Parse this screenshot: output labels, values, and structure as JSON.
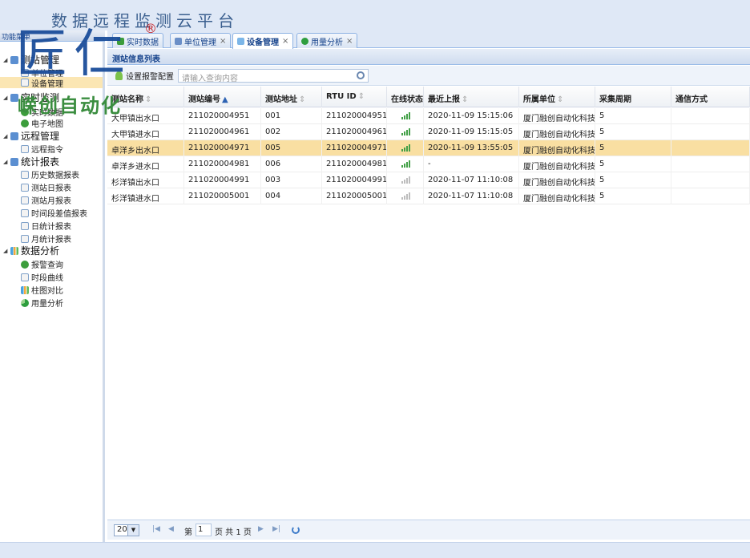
{
  "app": {
    "title": "数据远程监测云平台"
  },
  "nav": {
    "header": "功能菜单",
    "groups": [
      {
        "label": "测站管理",
        "items": [
          "单位管理",
          "设备管理"
        ]
      },
      {
        "label": "实时监测",
        "items": [
          "实时数据",
          "电子地图"
        ]
      },
      {
        "label": "远程管理",
        "items": [
          "远程指令"
        ]
      },
      {
        "label": "统计报表",
        "items": [
          "历史数据报表",
          "测站日报表",
          "测站月报表",
          "时间段差值报表",
          "日统计报表",
          "月统计报表"
        ]
      },
      {
        "label": "数据分析",
        "items": [
          "报警查询",
          "时段曲线",
          "柱图对比",
          "用量分析"
        ]
      }
    ]
  },
  "watermark": {
    "big": "匠仁",
    "reg": "®",
    "sub": "嵘创自动化"
  },
  "tabs": [
    {
      "label": "实时数据",
      "close": ""
    },
    {
      "label": "单位管理",
      "close": "×"
    },
    {
      "label": "设备管理",
      "close": "×"
    },
    {
      "label": "用量分析",
      "close": "×"
    }
  ],
  "panel": {
    "title": "测站信息列表"
  },
  "toolbar": {
    "alarm_config": "设置报警配置",
    "search_placeholder": "请输入查询内容"
  },
  "grid": {
    "columns": [
      "测站名称",
      "测站编号",
      "测站地址",
      "RTU ID",
      "在线状态",
      "最近上报",
      "所属单位",
      "采集周期",
      "通信方式"
    ],
    "rows": [
      {
        "name": "大甲镇出水口",
        "code": "211020004951",
        "addr": "001",
        "rtu": "211020004951",
        "online": true,
        "last": "2020-11-09 15:15:06",
        "unit": "厦门融创自动化科技",
        "period": "5"
      },
      {
        "name": "大甲镇进水口",
        "code": "211020004961",
        "addr": "002",
        "rtu": "211020004961",
        "online": true,
        "last": "2020-11-09 15:15:05",
        "unit": "厦门融创自动化科技",
        "period": "5"
      },
      {
        "name": "卓洋乡出水口",
        "code": "211020004971",
        "addr": "005",
        "rtu": "211020004971",
        "online": true,
        "last": "2020-11-09 13:55:05",
        "unit": "厦门融创自动化科技",
        "period": "5"
      },
      {
        "name": "卓洋乡进水口",
        "code": "211020004981",
        "addr": "006",
        "rtu": "211020004981",
        "online": true,
        "last": "-",
        "unit": "厦门融创自动化科技",
        "period": "5"
      },
      {
        "name": "杉洋镇出水口",
        "code": "211020004991",
        "addr": "003",
        "rtu": "211020004991",
        "online": false,
        "last": "2020-11-07 11:10:08",
        "unit": "厦门融创自动化科技",
        "period": "5"
      },
      {
        "name": "杉洋镇进水口",
        "code": "211020005001",
        "addr": "004",
        "rtu": "211020005001",
        "online": false,
        "last": "2020-11-07 11:10:08",
        "unit": "厦门融创自动化科技",
        "period": "5"
      }
    ],
    "selected_row": 2
  },
  "pager": {
    "page_size": "20",
    "page_prefix": "第",
    "page_value": "1",
    "page_suffix": "页 共 1 页"
  },
  "colors": {
    "header_bg": "#dfe8f6",
    "selected_row": "#f9dfa2",
    "online": "#43a047",
    "offline": "#bdbdbd",
    "title": "#3b5f8f"
  }
}
